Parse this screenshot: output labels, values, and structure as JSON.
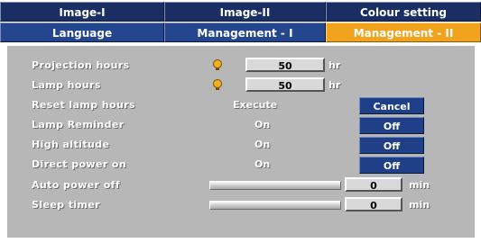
{
  "tabs": {
    "row1": [
      {
        "label": "Image-I"
      },
      {
        "label": "Image-II"
      },
      {
        "label": "Colour setting"
      }
    ],
    "row2": [
      {
        "label": "Language"
      },
      {
        "label": "Management - I"
      },
      {
        "label": "Management - II",
        "active": true
      }
    ]
  },
  "menu": {
    "projection_hours": {
      "label": "Projection hours",
      "value": "50",
      "unit": "hr",
      "icon": "lamp-bulb-icon"
    },
    "lamp_hours": {
      "label": "Lamp hours",
      "value": "50",
      "unit": "hr",
      "icon": "lamp-bulb-icon"
    },
    "reset_lamp_hours": {
      "label": "Reset lamp hours",
      "value": "Execute",
      "button": "Cancel"
    },
    "lamp_reminder": {
      "label": "Lamp Reminder",
      "value": "On",
      "button": "Off"
    },
    "high_altitude": {
      "label": "High altitude",
      "value": "On",
      "button": "Off"
    },
    "direct_power_on": {
      "label": "Direct power on",
      "value": "On",
      "button": "Off"
    },
    "auto_power_off": {
      "label": "Auto power off",
      "value": "0",
      "unit": "min",
      "slider_level": 0
    },
    "sleep_timer": {
      "label": "Sleep timer",
      "value": "0",
      "unit": "min",
      "slider_level": 0
    }
  },
  "colors": {
    "tab_dark": "#1a2e63",
    "tab_blue": "#23468e",
    "tab_active": "#f2a31d",
    "panel": "#b7b7b7",
    "button": "#1f3f86"
  }
}
